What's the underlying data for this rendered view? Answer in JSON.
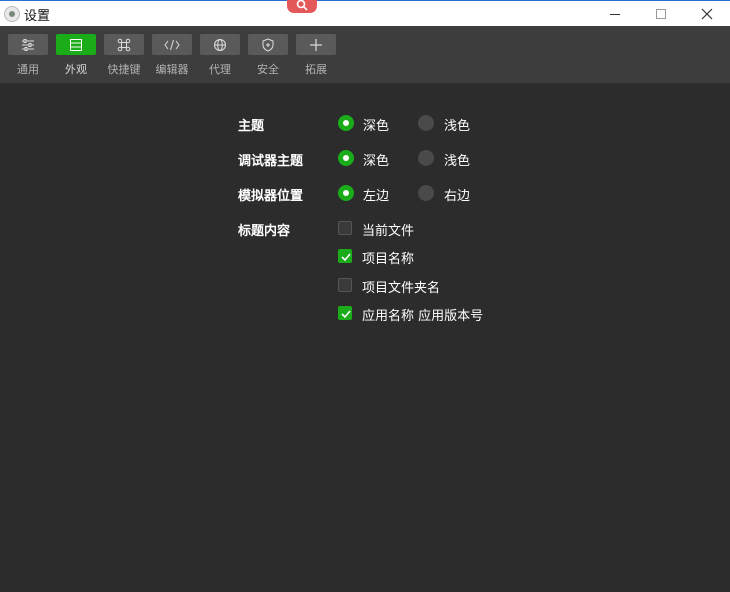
{
  "window": {
    "title": "设置"
  },
  "toolbar": {
    "items": [
      {
        "label": "通用",
        "icon": "sliders-icon",
        "active": false
      },
      {
        "label": "外观",
        "icon": "layout-icon",
        "active": true
      },
      {
        "label": "快捷键",
        "icon": "command-key-icon",
        "active": false
      },
      {
        "label": "编辑器",
        "icon": "code-icon",
        "active": false
      },
      {
        "label": "代理",
        "icon": "globe-icon",
        "active": false
      },
      {
        "label": "安全",
        "icon": "shield-icon",
        "active": false
      },
      {
        "label": "拓展",
        "icon": "plus-icon",
        "active": false
      }
    ]
  },
  "settings": {
    "theme": {
      "label": "主题",
      "options": [
        "深色",
        "浅色"
      ],
      "selected": "深色"
    },
    "debugger_theme": {
      "label": "调试器主题",
      "options": [
        "深色",
        "浅色"
      ],
      "selected": "深色"
    },
    "simulator_position": {
      "label": "模拟器位置",
      "options": [
        "左边",
        "右边"
      ],
      "selected": "左边"
    },
    "title_content": {
      "label": "标题内容",
      "options": [
        {
          "label": "当前文件",
          "checked": false
        },
        {
          "label": "项目名称",
          "checked": true
        },
        {
          "label": "项目文件夹名",
          "checked": false
        },
        {
          "label": "应用名称 应用版本号",
          "checked": true
        }
      ]
    }
  },
  "colors": {
    "accent": "#1aad19",
    "background": "#2c2c2c",
    "toolbar": "#3d3d3d"
  }
}
